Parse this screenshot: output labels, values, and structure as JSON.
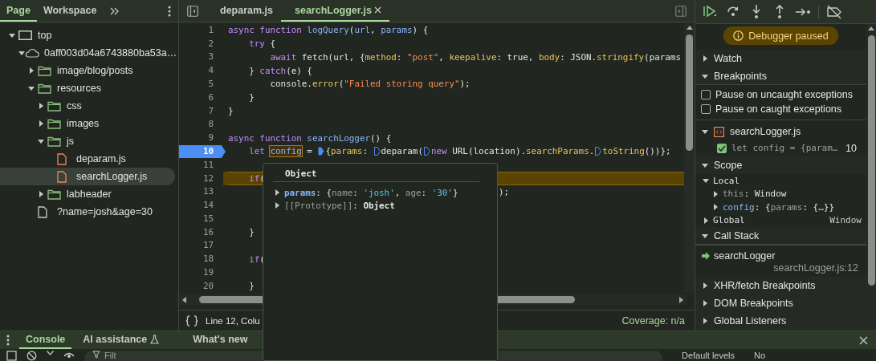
{
  "left_panel": {
    "tabs": [
      {
        "label": "Page",
        "selected": true
      },
      {
        "label": "Workspace",
        "selected": false
      }
    ],
    "tree": [
      {
        "label": "top",
        "kind": "frame",
        "expanded": true,
        "selected": false,
        "children": [
          {
            "label": "0aff003d04a6743880ba53a…",
            "kind": "domain",
            "expanded": true,
            "selected": false,
            "children": [
              {
                "label": "image/blog/posts",
                "kind": "folder",
                "expanded": false,
                "selected": false
              },
              {
                "label": "resources",
                "kind": "folder",
                "expanded": true,
                "selected": false,
                "children": [
                  {
                    "label": "css",
                    "kind": "folder",
                    "expanded": false,
                    "selected": false
                  },
                  {
                    "label": "images",
                    "kind": "folder",
                    "expanded": false,
                    "selected": false
                  },
                  {
                    "label": "js",
                    "kind": "folder",
                    "expanded": true,
                    "selected": false,
                    "children": [
                      {
                        "label": "deparam.js",
                        "kind": "script",
                        "selected": false
                      },
                      {
                        "label": "searchLogger.js",
                        "kind": "script",
                        "selected": true
                      }
                    ]
                  },
                  {
                    "label": "labheader",
                    "kind": "folder",
                    "expanded": false,
                    "selected": false
                  }
                ]
              },
              {
                "label": "?name=josh&age=30",
                "kind": "document",
                "selected": false
              }
            ]
          }
        ]
      }
    ]
  },
  "editor": {
    "tabs": [
      {
        "label": "deparam.js",
        "selected": false,
        "closable": false
      },
      {
        "label": "searchLogger.js",
        "selected": true,
        "closable": true
      }
    ],
    "lines": [
      {
        "number": "1",
        "breakpoint": false,
        "paused": false,
        "tokens": [
          {
            "kind": "kw",
            "text": "async function "
          },
          {
            "kind": "def",
            "text": "logQuery"
          },
          {
            "kind": "plain",
            "text": "("
          },
          {
            "kind": "def",
            "text": "url"
          },
          {
            "kind": "plain",
            "text": ", "
          },
          {
            "kind": "def",
            "text": "params"
          },
          {
            "kind": "plain",
            "text": ") {"
          }
        ]
      },
      {
        "number": "2",
        "breakpoint": false,
        "paused": false,
        "tokens": [
          {
            "kind": "kw",
            "text": "    try"
          },
          {
            "kind": "plain",
            "text": " {"
          }
        ]
      },
      {
        "number": "3",
        "breakpoint": false,
        "paused": false,
        "tokens": [
          {
            "kind": "kw",
            "text": "        await"
          },
          {
            "kind": "plain",
            "text": " fetch(url, {"
          },
          {
            "kind": "prop",
            "text": "method"
          },
          {
            "kind": "plain",
            "text": ": "
          },
          {
            "kind": "str",
            "text": "\"post\""
          },
          {
            "kind": "plain",
            "text": ", "
          },
          {
            "kind": "prop",
            "text": "keepalive"
          },
          {
            "kind": "plain",
            "text": ": true, "
          },
          {
            "kind": "prop",
            "text": "body"
          },
          {
            "kind": "plain",
            "text": ": JSON."
          },
          {
            "kind": "prop",
            "text": "stringify"
          },
          {
            "kind": "plain",
            "text": "(params"
          }
        ]
      },
      {
        "number": "4",
        "breakpoint": false,
        "paused": false,
        "tokens": [
          {
            "kind": "plain",
            "text": "    } "
          },
          {
            "kind": "kw",
            "text": "catch"
          },
          {
            "kind": "plain",
            "text": "(e) {"
          }
        ]
      },
      {
        "number": "5",
        "breakpoint": false,
        "paused": false,
        "tokens": [
          {
            "kind": "plain",
            "text": "        console."
          },
          {
            "kind": "prop",
            "text": "error"
          },
          {
            "kind": "plain",
            "text": "("
          },
          {
            "kind": "str",
            "text": "\"Failed storing query\""
          },
          {
            "kind": "plain",
            "text": ");"
          }
        ]
      },
      {
        "number": "6",
        "breakpoint": false,
        "paused": false,
        "tokens": [
          {
            "kind": "plain",
            "text": "    }"
          }
        ]
      },
      {
        "number": "7",
        "breakpoint": false,
        "paused": false,
        "tokens": [
          {
            "kind": "plain",
            "text": "}"
          }
        ]
      },
      {
        "number": "8",
        "breakpoint": false,
        "paused": false
      },
      {
        "number": "9",
        "breakpoint": false,
        "paused": false,
        "tokens": [
          {
            "kind": "kw",
            "text": "async function "
          },
          {
            "kind": "def",
            "text": "searchLogger"
          },
          {
            "kind": "plain",
            "text": "() {"
          }
        ]
      },
      {
        "number": "10",
        "breakpoint": true,
        "paused": false,
        "tokens": [
          {
            "kind": "kw",
            "text": "    let "
          },
          {
            "kind": "hover",
            "text": "config"
          },
          {
            "kind": "plain",
            "text": " = "
          },
          {
            "kind": "marker",
            "active": true
          },
          {
            "kind": "plain",
            "text": "{"
          },
          {
            "kind": "prop",
            "text": "params"
          },
          {
            "kind": "plain",
            "text": ": "
          },
          {
            "kind": "marker",
            "active": false
          },
          {
            "kind": "plain",
            "text": "deparam("
          },
          {
            "kind": "marker",
            "active": false
          },
          {
            "kind": "kw",
            "text": "new"
          },
          {
            "kind": "plain",
            "text": " URL(location)."
          },
          {
            "kind": "prop",
            "text": "searchParams"
          },
          {
            "kind": "plain",
            "text": "."
          },
          {
            "kind": "marker",
            "active": false
          },
          {
            "kind": "prop",
            "text": "toString"
          },
          {
            "kind": "plain",
            "text": "())};"
          }
        ]
      },
      {
        "number": "11",
        "breakpoint": false,
        "paused": false
      },
      {
        "number": "12",
        "breakpoint": false,
        "paused": true,
        "tokens": [
          {
            "kind": "kw",
            "text": "    if"
          },
          {
            "kind": "plain",
            "text": "("
          }
        ]
      },
      {
        "number": "13",
        "breakpoint": false,
        "paused": false,
        "tokens": [
          {
            "kind": "tail",
            "text": ");"
          }
        ]
      },
      {
        "number": "14",
        "breakpoint": false,
        "paused": false
      },
      {
        "number": "15",
        "breakpoint": false,
        "paused": false
      },
      {
        "number": "16",
        "breakpoint": false,
        "paused": false,
        "tokens": [
          {
            "kind": "plain",
            "text": "    }"
          }
        ]
      },
      {
        "number": "17",
        "breakpoint": false,
        "paused": false
      },
      {
        "number": "18",
        "breakpoint": false,
        "paused": false,
        "tokens": [
          {
            "kind": "kw",
            "text": "    if"
          },
          {
            "kind": "plain",
            "text": "("
          }
        ]
      },
      {
        "number": "19",
        "breakpoint": false,
        "paused": false
      },
      {
        "number": "20",
        "breakpoint": false,
        "paused": false,
        "tokens": [
          {
            "kind": "plain",
            "text": "    }"
          }
        ]
      }
    ],
    "popup": {
      "title": "Object",
      "rows": [
        {
          "expanded": false,
          "tokens": [
            {
              "kind": "key",
              "text": "params"
            },
            {
              "kind": "plain",
              "text": ": {"
            },
            {
              "kind": "dim",
              "text": "name"
            },
            {
              "kind": "plain",
              "text": ": "
            },
            {
              "kind": "val",
              "text": "'josh'"
            },
            {
              "kind": "plain",
              "text": ", "
            },
            {
              "kind": "dim",
              "text": "age"
            },
            {
              "kind": "plain",
              "text": ": "
            },
            {
              "kind": "val",
              "text": "'30'"
            },
            {
              "kind": "plain",
              "text": "}"
            }
          ]
        },
        {
          "expanded": false,
          "tokens": [
            {
              "kind": "dim",
              "text": "[[Prototype]]"
            },
            {
              "kind": "plain",
              "text": ": "
            },
            {
              "kind": "bold",
              "text": "Object"
            }
          ]
        }
      ]
    },
    "status": {
      "position": "Line 12, Colu",
      "coverage": "Coverage: n/a"
    }
  },
  "debugger": {
    "status": "Debugger paused",
    "sections": [
      {
        "kind": "plain",
        "title": "Watch",
        "expanded": false
      },
      {
        "kind": "breakpoints",
        "title": "Breakpoints",
        "expanded": true,
        "options": [
          {
            "label": "Pause on uncaught exceptions",
            "checked": false
          },
          {
            "label": "Pause on caught exceptions",
            "checked": false
          }
        ],
        "files": [
          {
            "name": "searchLogger.js",
            "expanded": true,
            "breakpoints": [
              {
                "code": "let config = {param…",
                "line": "10",
                "checked": true
              }
            ]
          }
        ]
      },
      {
        "kind": "scope",
        "title": "Scope",
        "expanded": true,
        "scopes": [
          {
            "name": "Local",
            "expanded": true,
            "vars": [
              {
                "expanded": false,
                "tokens": [
                  {
                    "kind": "dim",
                    "text": "this"
                  },
                  {
                    "kind": "plain",
                    "text": ": Window"
                  }
                ]
              },
              {
                "expanded": false,
                "tokens": [
                  {
                    "kind": "key",
                    "text": "config"
                  },
                  {
                    "kind": "plain",
                    "text": ": {"
                  },
                  {
                    "kind": "dim",
                    "text": "params"
                  },
                  {
                    "kind": "plain",
                    "text": ": {…}}"
                  }
                ]
              }
            ]
          },
          {
            "name": "Global",
            "expanded": false,
            "value": "Window"
          }
        ]
      },
      {
        "kind": "callstack",
        "title": "Call Stack",
        "expanded": true,
        "frames": [
          {
            "name": "searchLogger",
            "location": "searchLogger.js:12",
            "current": true
          }
        ]
      },
      {
        "kind": "plain",
        "title": "XHR/fetch Breakpoints",
        "expanded": false
      },
      {
        "kind": "plain",
        "title": "DOM Breakpoints",
        "expanded": false
      },
      {
        "kind": "plain",
        "title": "Global Listeners",
        "expanded": false
      }
    ]
  },
  "drawer": {
    "tabs": [
      {
        "label": "Console",
        "selected": true,
        "experimental": false
      },
      {
        "label": "AI assistance",
        "selected": false,
        "experimental": true
      },
      {
        "label": "What's new",
        "selected": false,
        "experimental": false
      }
    ],
    "filter_placeholder": "Filt",
    "levels": "Default levels",
    "issues": "No"
  }
}
